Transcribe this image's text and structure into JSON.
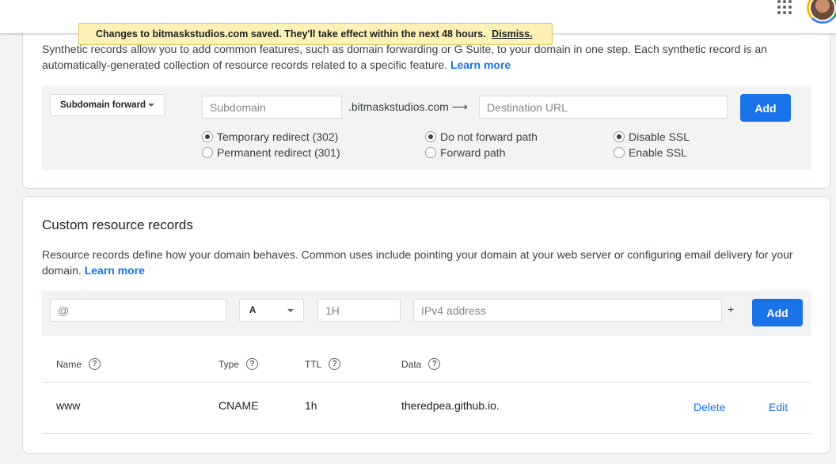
{
  "toast": {
    "message": "Changes to bitmaskstudios.com saved. They'll take effect within the next 48 hours.",
    "dismiss": "Dismiss."
  },
  "synthetic": {
    "description": "Synthetic records allow you to add common features, such as domain forwarding or G Suite, to your domain in one step. Each synthetic record is an automatically-generated collection of resource records related to a specific feature.",
    "learn_more": "Learn more",
    "type_select": "Subdomain forward",
    "subdomain_placeholder": "Subdomain",
    "domain_suffix": ".bitmaskstudios.com ⟶",
    "destination_placeholder": "Destination URL",
    "add_label": "Add",
    "redirect_options": [
      {
        "label": "Temporary redirect (302)",
        "checked": true
      },
      {
        "label": "Permanent redirect (301)",
        "checked": false
      }
    ],
    "path_options": [
      {
        "label": "Do not forward path",
        "checked": true
      },
      {
        "label": "Forward path",
        "checked": false
      }
    ],
    "ssl_options": [
      {
        "label": "Disable SSL",
        "checked": true
      },
      {
        "label": "Enable SSL",
        "checked": false
      }
    ]
  },
  "custom": {
    "title": "Custom resource records",
    "description": "Resource records define how your domain behaves. Common uses include pointing your domain at your web server or configuring email delivery for your domain.",
    "learn_more": "Learn more",
    "name_placeholder": "@",
    "type_select": "A",
    "ttl_placeholder": "1H",
    "data_placeholder": "IPv4 address",
    "plus": "+",
    "add_label": "Add",
    "columns": {
      "name": "Name",
      "type": "Type",
      "ttl": "TTL",
      "data": "Data"
    },
    "help_glyph": "?",
    "rows": [
      {
        "name": "www",
        "type": "CNAME",
        "ttl": "1h",
        "data": "theredpea.github.io.",
        "delete": "Delete",
        "edit": "Edit"
      }
    ]
  },
  "icons": {
    "apps": "apps-grid-icon",
    "avatar": "user-avatar",
    "help": "help-circle-icon",
    "caret": "caret-down-icon"
  },
  "colors": {
    "accent": "#1a73e8",
    "toast_bg": "#fdf1b6",
    "panel_bg": "#f1f3f4"
  }
}
